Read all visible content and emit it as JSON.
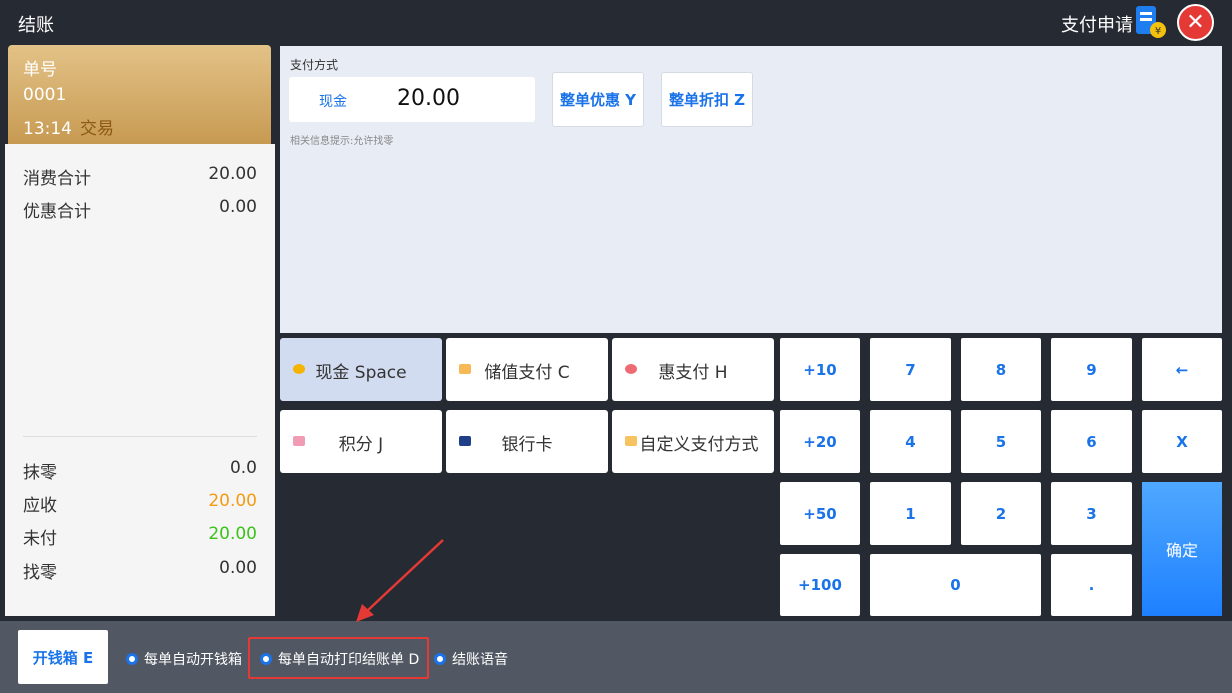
{
  "header": {
    "title": "结账",
    "pay_apply_label": "支付申请",
    "pay_apply_badge": "¥"
  },
  "order": {
    "no_label": "单号",
    "no_value": "0001",
    "time": "13:14",
    "status": "交易"
  },
  "summary": {
    "rows_top": [
      {
        "label": "消费合计",
        "value": "20.00"
      },
      {
        "label": "优惠合计",
        "value": "0.00"
      }
    ],
    "rows_bottom": [
      {
        "label": "抹零",
        "value": "0.0",
        "color": "#333333"
      },
      {
        "label": "应收",
        "value": "20.00",
        "color": "#f39c12"
      },
      {
        "label": "未付",
        "value": "20.00",
        "color": "#3cc21a"
      },
      {
        "label": "找零",
        "value": "0.00",
        "color": "#333333"
      }
    ]
  },
  "pay_area": {
    "caption": "支付方式",
    "method_name": "现金",
    "method_value": "20.00",
    "hint": "相关信息提示:允许找零",
    "btn_discount": "整单优惠 Y",
    "btn_rebate": "整单折扣 Z"
  },
  "pay_types": [
    {
      "label": "现金 Space",
      "icon": "yen-coin-icon",
      "color": "#f4b400",
      "active": true
    },
    {
      "label": "储值支付 C",
      "icon": "card-icon",
      "color": "#f7b955",
      "active": false
    },
    {
      "label": "惠支付 H",
      "icon": "hui-pay-icon",
      "color": "#ef6b73",
      "active": false
    },
    {
      "label": "积分 J",
      "icon": "points-icon",
      "color": "#f29bb4",
      "active": false
    },
    {
      "label": "银行卡",
      "icon": "unionpay-icon",
      "color": "#1f3f88",
      "active": false
    },
    {
      "label": "自定义支付方式",
      "icon": "custom-pay-icon",
      "color": "#f7c260",
      "active": false
    }
  ],
  "keypad": {
    "plus10": "+10",
    "plus20": "+20",
    "plus50": "+50",
    "plus100": "+100",
    "k7": "7",
    "k8": "8",
    "k9": "9",
    "k4": "4",
    "k5": "5",
    "k6": "6",
    "k1": "1",
    "k2": "2",
    "k3": "3",
    "k0": "0",
    "dot": ".",
    "backspace": "←",
    "clear": "X",
    "confirm": "确定"
  },
  "bottom": {
    "cash_drawer": "开钱箱 E",
    "opt1": "每单自动开钱箱",
    "opt2": "每单自动打印结账单 D",
    "opt3": "结账语音"
  }
}
